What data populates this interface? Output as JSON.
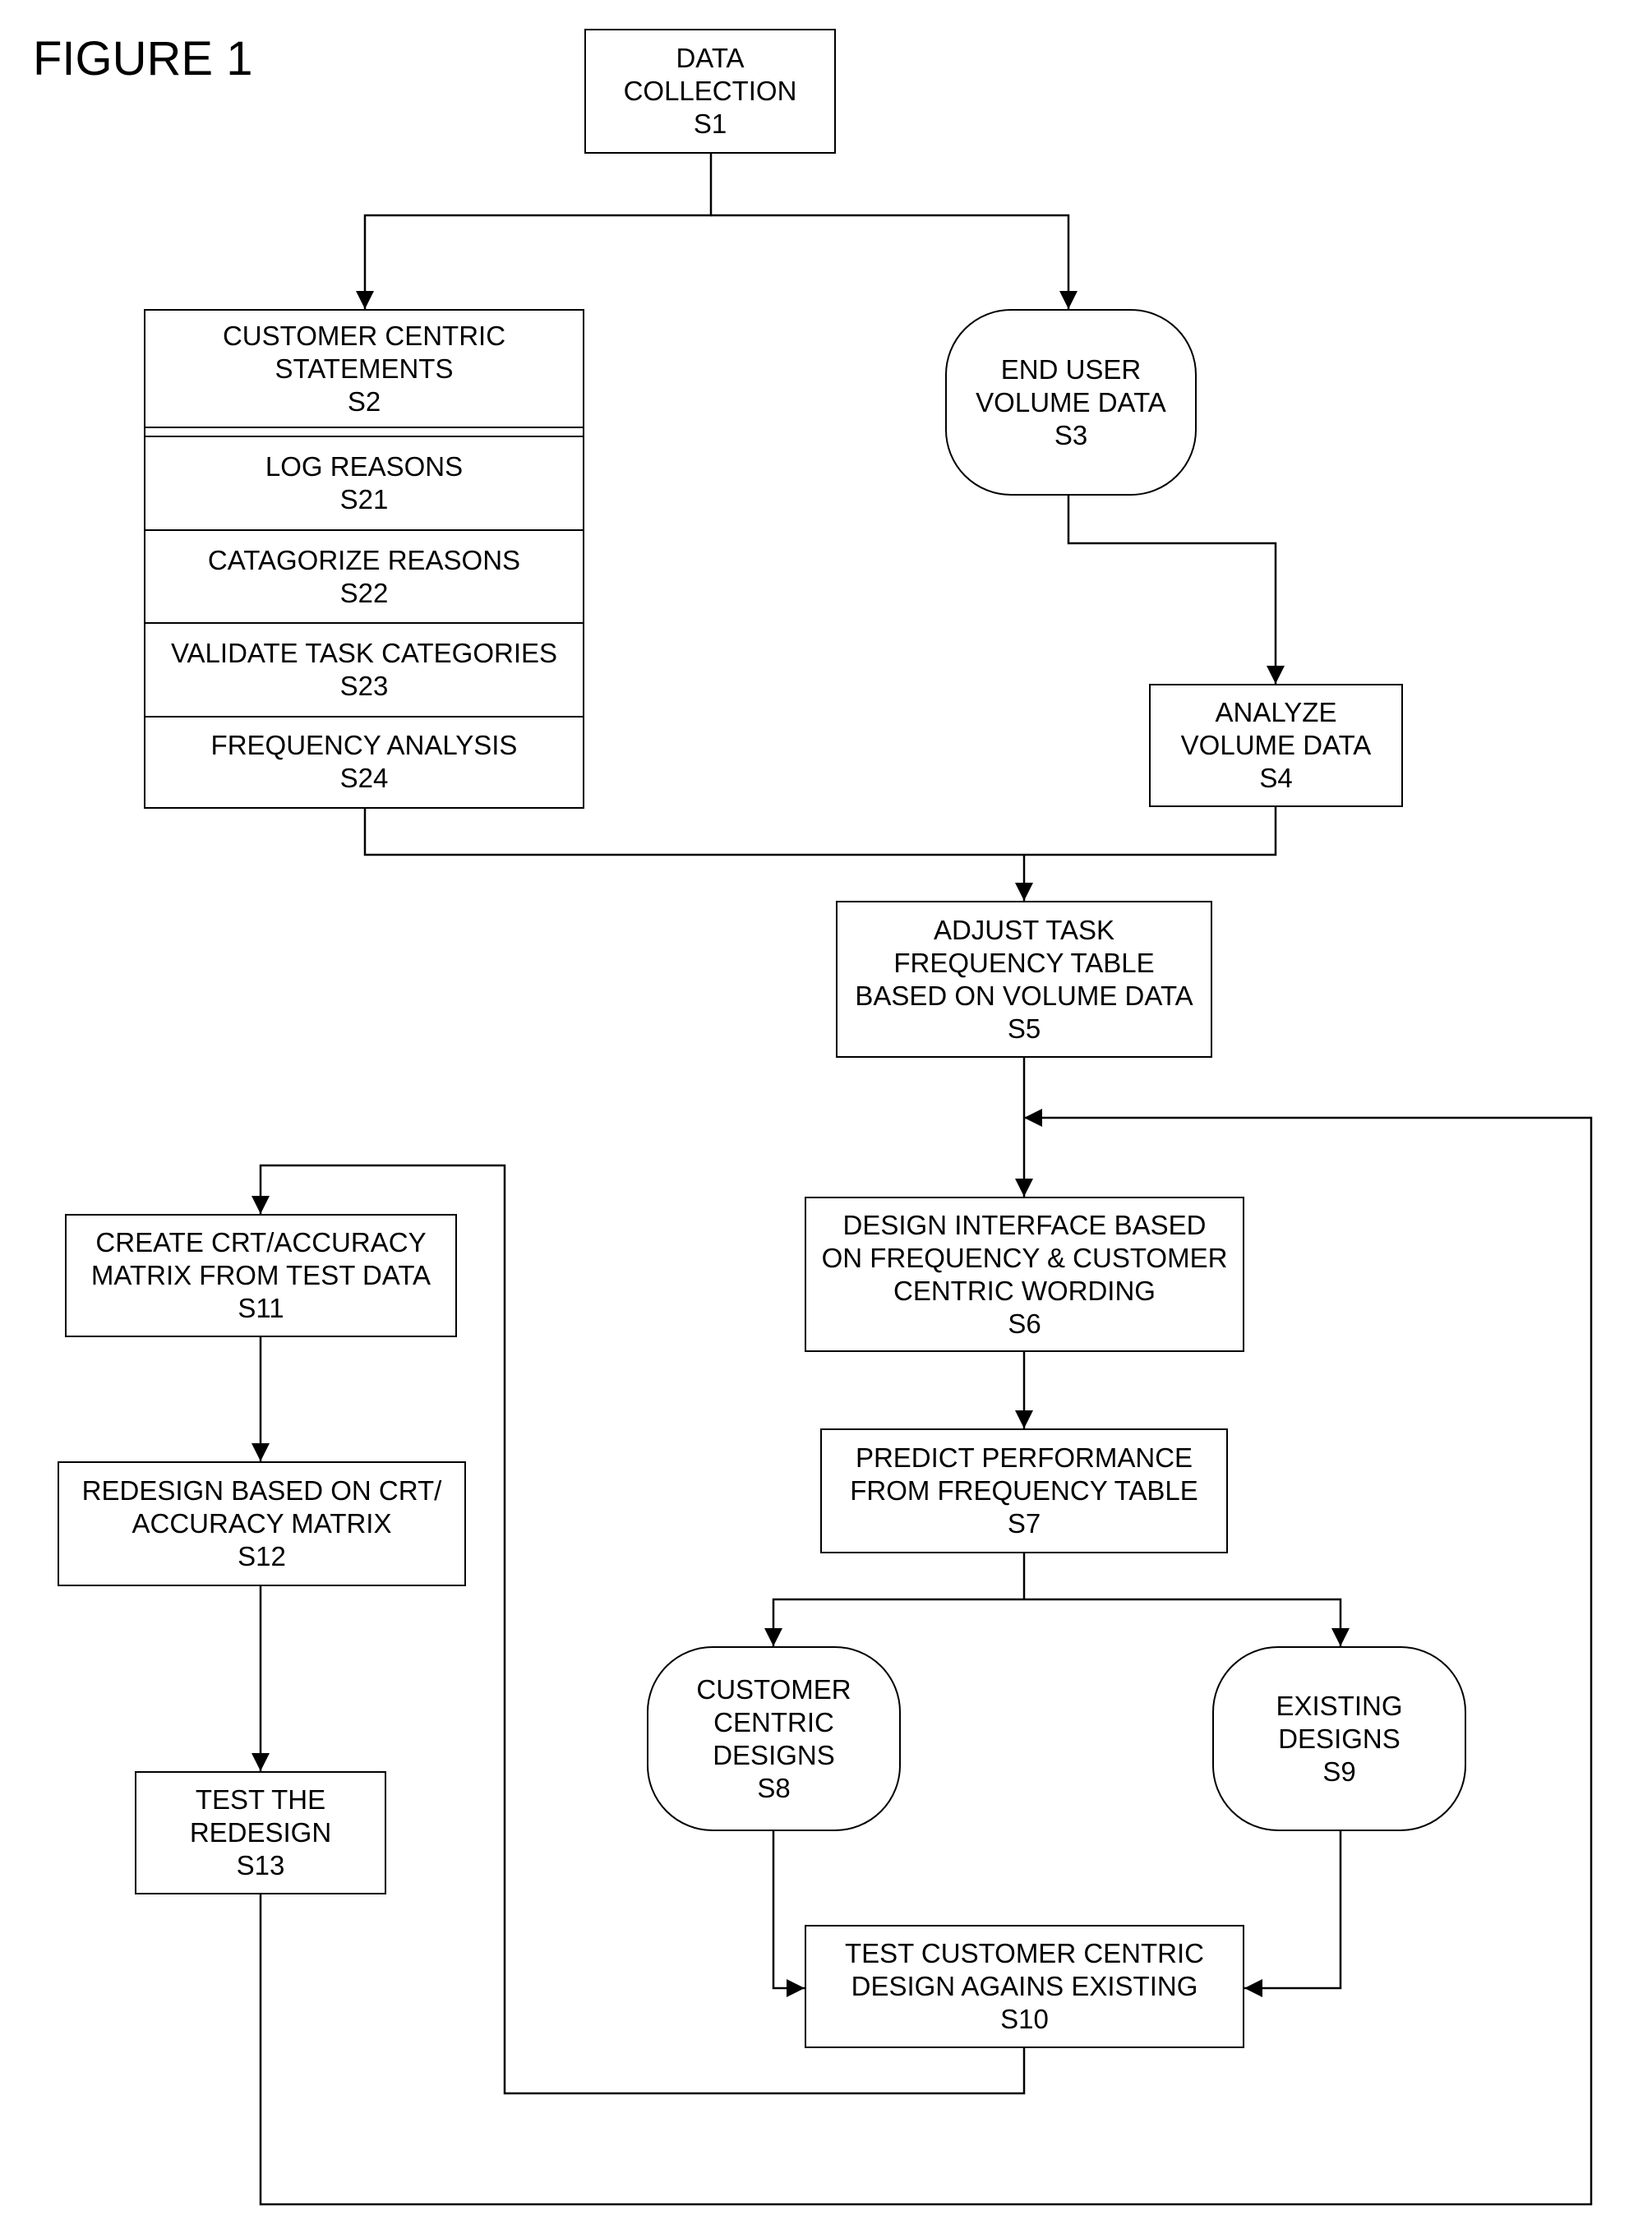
{
  "figure": {
    "title": "FIGURE 1"
  },
  "nodes": {
    "s1": {
      "lines": [
        "DATA",
        "COLLECTION"
      ],
      "step": "S1",
      "shape": "rectangle"
    },
    "s2": {
      "lines": [
        "CUSTOMER CENTRIC",
        "STATEMENTS"
      ],
      "step": "S2",
      "shape": "rectangle",
      "substeps": [
        {
          "lines": [
            "LOG REASONS"
          ],
          "step": "S21"
        },
        {
          "lines": [
            "CATAGORIZE REASONS"
          ],
          "step": "S22"
        },
        {
          "lines": [
            "VALIDATE TASK CATEGORIES"
          ],
          "step": "S23"
        },
        {
          "lines": [
            "FREQUENCY ANALYSIS"
          ],
          "step": "S24"
        }
      ]
    },
    "s3": {
      "lines": [
        "END USER",
        "VOLUME DATA"
      ],
      "step": "S3",
      "shape": "rounded"
    },
    "s4": {
      "lines": [
        "ANALYZE",
        "VOLUME DATA"
      ],
      "step": "S4",
      "shape": "rectangle"
    },
    "s5": {
      "lines": [
        "ADJUST TASK",
        "FREQUENCY TABLE",
        "BASED ON VOLUME DATA"
      ],
      "step": "S5",
      "shape": "rectangle"
    },
    "s6": {
      "lines": [
        "DESIGN INTERFACE BASED",
        "ON FREQUENCY & CUSTOMER",
        "CENTRIC WORDING"
      ],
      "step": "S6",
      "shape": "rectangle"
    },
    "s7": {
      "lines": [
        "PREDICT PERFORMANCE",
        "FROM FREQUENCY TABLE"
      ],
      "step": "S7",
      "shape": "rectangle"
    },
    "s8": {
      "lines": [
        "CUSTOMER",
        "CENTRIC",
        "DESIGNS"
      ],
      "step": "S8",
      "shape": "rounded"
    },
    "s9": {
      "lines": [
        "EXISTING",
        "DESIGNS"
      ],
      "step": "S9",
      "shape": "rounded"
    },
    "s10": {
      "lines": [
        "TEST CUSTOMER CENTRIC",
        "DESIGN AGAINS EXISTING"
      ],
      "step": "S10",
      "shape": "rectangle"
    },
    "s11": {
      "lines": [
        "CREATE CRT/ACCURACY",
        "MATRIX FROM TEST DATA"
      ],
      "step": "S11",
      "shape": "rectangle"
    },
    "s12": {
      "lines": [
        "REDESIGN BASED ON CRT/",
        "ACCURACY MATRIX"
      ],
      "step": "S12",
      "shape": "rectangle"
    },
    "s13": {
      "lines": [
        "TEST THE",
        "REDESIGN"
      ],
      "step": "S13",
      "shape": "rectangle"
    }
  },
  "edges": [
    {
      "from": "S1",
      "to": "S2"
    },
    {
      "from": "S1",
      "to": "S3"
    },
    {
      "from": "S3",
      "to": "S4"
    },
    {
      "from": "S24",
      "to": "S5"
    },
    {
      "from": "S4",
      "to": "S5"
    },
    {
      "from": "S5",
      "to": "S6"
    },
    {
      "from": "S6",
      "to": "S7"
    },
    {
      "from": "S7",
      "to": "S8"
    },
    {
      "from": "S7",
      "to": "S9"
    },
    {
      "from": "S8",
      "to": "S10"
    },
    {
      "from": "S9",
      "to": "S10"
    },
    {
      "from": "S10",
      "to": "S11"
    },
    {
      "from": "S11",
      "to": "S12"
    },
    {
      "from": "S12",
      "to": "S13"
    },
    {
      "from": "S13",
      "to": "S6"
    }
  ]
}
